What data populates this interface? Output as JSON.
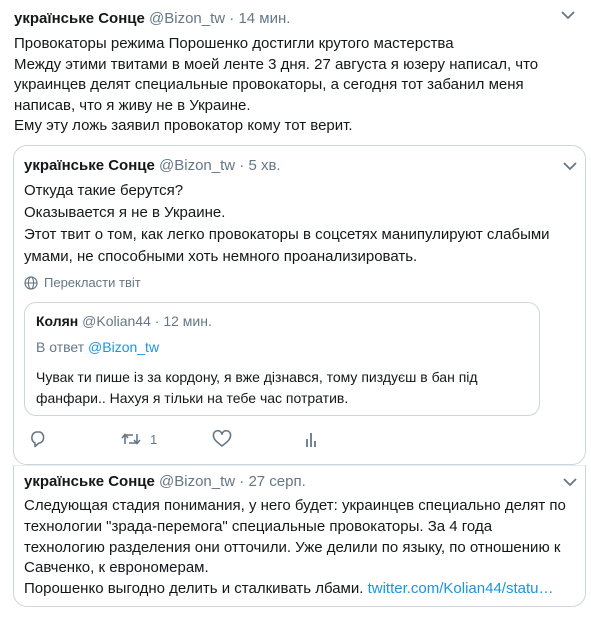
{
  "main_tweet": {
    "author_name": "українськe Сонце",
    "author_handle": "@Bizon_tw",
    "separator": "·",
    "time": "14 мин.",
    "lines": [
      "Провокаторы режима Порошенко достигли крутого мастерства",
      "Между этими твитами в моей ленте 3 дня. 27 августа я юзеру написал, что",
      "украинцев делят специальные провокаторы, а сегодня тот забанил меня",
      "написав, что я живу не в Украине.",
      "Ему эту ложь заявил провокатор кому тот верит."
    ]
  },
  "quoted_tweet": {
    "author_name": "українськe Сонце",
    "author_handle": "@Bizon_tw",
    "separator": "·",
    "time": "5 хв.",
    "lines": [
      "Откуда такие берутся?",
      "Оказывается я не в Украине.",
      "Этот твит о том, как легко провокаторы в соцсетях манипулируют слабыми",
      "умами, не способными хоть немного проанализировать."
    ],
    "translate_label": "Перекласти твіт",
    "nested": {
      "author_name": "Колян",
      "author_handle": "@Kolian44",
      "separator": "·",
      "time": "12 мин.",
      "reply_prefix": "В ответ",
      "reply_mention": "@Bizon_tw",
      "lines": [
        "Чувак ти пише із за кордону, я вже дізнався, тому пиздуєш в бан під",
        "фанфари.. Нахуя я тільки на тебе час потратив."
      ]
    },
    "actions": {
      "retweet_count": "1"
    }
  },
  "second_tweet": {
    "author_name": "українськe Сонце",
    "author_handle": "@Bizon_tw",
    "separator": "·",
    "time": "27 серп.",
    "lines": [
      "Следующая стадия понимания, у него будет: украинцев специально делят по",
      "технологии \"зрада-перемога\" специальные провокаторы. За 4 года",
      "технологию разделения они отточили. Уже делили по языку, по отношению к",
      "Савченко, к евр​ономерам."
    ],
    "last_line_text": "Порошенко выгодно делить и сталкивать лбами.",
    "last_line_link": "twitter.com/Kolian44/statu…"
  },
  "colors": {
    "text": "#14171a",
    "muted": "#657786",
    "link": "#1b95e0",
    "border": "#ccd6dd"
  },
  "icons": [
    "chevron-down-icon",
    "globe-icon",
    "reply-icon",
    "retweet-icon",
    "like-icon",
    "analytics-icon"
  ]
}
